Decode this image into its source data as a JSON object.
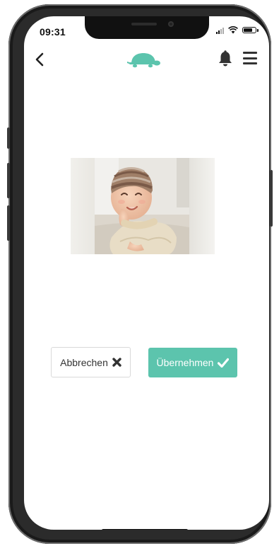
{
  "status_bar": {
    "time": "09:31"
  },
  "header": {
    "back_icon": "chevron-left-icon",
    "logo_icon": "turtle-logo-icon",
    "bell_icon": "bell-icon",
    "menu_icon": "hamburger-menu-icon",
    "accent_color": "#5cc4ad"
  },
  "preview": {
    "image": "baby-photo"
  },
  "actions": {
    "cancel_label": "Abbrechen",
    "cancel_icon": "close-icon",
    "apply_label": "Übernehmen",
    "apply_icon": "checkmark-icon"
  }
}
